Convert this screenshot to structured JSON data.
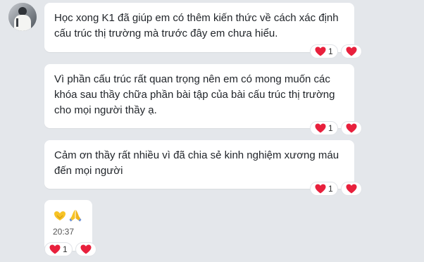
{
  "sender": {
    "avatar_icon": "user-avatar"
  },
  "messages": [
    {
      "text": "Học xong K1 đã giúp em có thêm kiến thức về cách xác định cấu trúc thị trường mà trước đây em chưa hiểu.",
      "reaction_count": "1"
    },
    {
      "text": "Vì phần cấu trúc rất quan trọng nên em  có mong muốn các khóa sau thầy chữa phần bài tập của bài cấu trúc thị trường cho mọi người thầy ạ.",
      "reaction_count": "1"
    },
    {
      "text": "Cảm ơn thầy rất nhiều vì đã chia sẻ kinh nghiệm xương máu đến mọi người",
      "reaction_count": "1"
    },
    {
      "emojis": [
        "heart-hands-emoji",
        "folded-hands-emoji"
      ],
      "time": "20:37",
      "reaction_count": "1"
    }
  ],
  "colors": {
    "heart": "#e8203c",
    "emoji_yellow": "#f7c325"
  }
}
